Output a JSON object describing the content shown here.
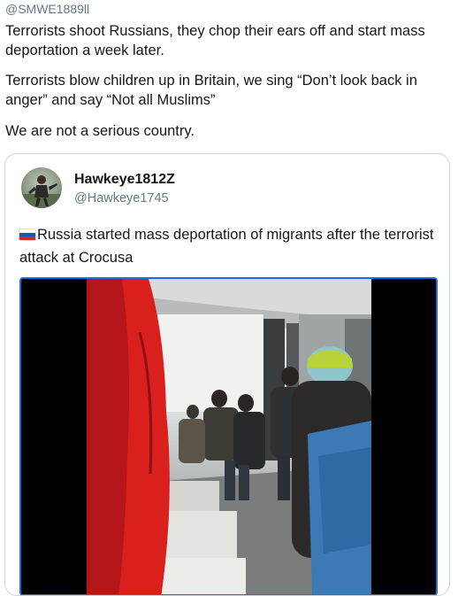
{
  "tweet": {
    "handle": "@SMWE1889ll",
    "paragraphs": [
      "Terrorists shoot Russians, they chop their ears off and start mass deportation a week later.",
      "Terrorists blow children up in Britain, we sing “Don’t look back in anger” and say “Not all Muslims”",
      "We are not a serious country."
    ]
  },
  "quoted_tweet": {
    "display_name": "Hawkeye1812Z",
    "handle": "@Hawkeye1745",
    "flag_icon": "russia-flag-icon",
    "text": "Russia started mass deportation of migrants after the terrorist attack at Crocusa"
  },
  "colors": {
    "text": "#14171a",
    "secondary_text": "#657786",
    "card_border": "#ccd6dd",
    "media_border": "#1d6fd8"
  }
}
